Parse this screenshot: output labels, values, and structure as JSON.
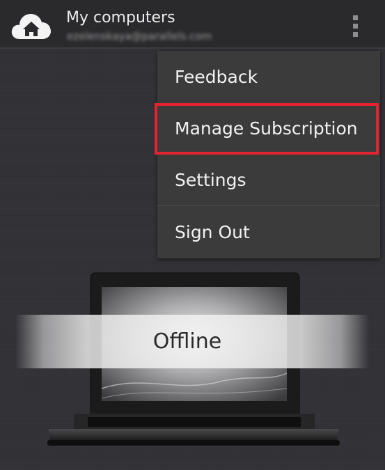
{
  "header": {
    "title": "My computers",
    "account_email": "ezelenskaya@parallels.com",
    "app_icon": "cloud-home-icon",
    "overflow_icon": "overflow-menu-icon"
  },
  "menu": {
    "items": [
      {
        "label": "Feedback"
      },
      {
        "label": "Manage Subscription",
        "highlighted": true
      },
      {
        "label": "Settings"
      },
      {
        "label": "Sign Out"
      }
    ]
  },
  "computer": {
    "status": "Offline",
    "image": "laptop-icon"
  },
  "colors": {
    "highlight": "#e5222f",
    "menu_background": "#3b3b3c",
    "screen_background": "#323236"
  }
}
